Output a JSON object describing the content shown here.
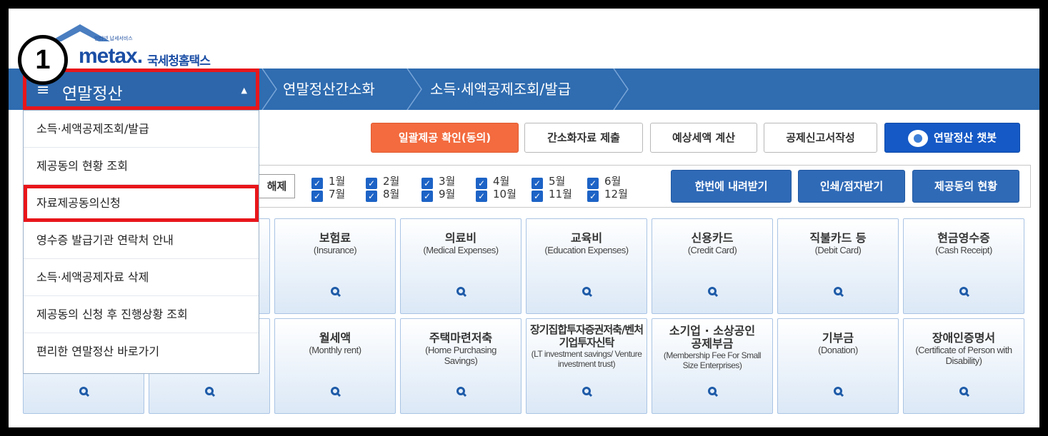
{
  "annotation": {
    "step": "1"
  },
  "logo": {
    "tagline": "인터넷 납세서비스",
    "brand": "metax.",
    "name_kr": "국세청홈택스"
  },
  "nav": {
    "menu_title": "연말정산",
    "breadcrumbs": [
      "연말정산간소화",
      "소득·세액공제조회/발급"
    ]
  },
  "dropdown": {
    "items": [
      "소득·세액공제조회/발급",
      "제공동의 현황 조회",
      "자료제공동의신청",
      "영수증 발급기관 연락처 안내",
      "소득·세액공제자료 삭제",
      "제공동의 신청 후 진행상황 조회",
      "편리한 연말정산 바로가기"
    ],
    "highlighted_index": 2
  },
  "actions": {
    "bulk_consent": "일괄제공 확인(동의)",
    "submit_data": "간소화자료 제출",
    "estimate_tax": "예상세액 계산",
    "write_return": "공제신고서작성",
    "chatbot": "연말정산 챗봇"
  },
  "filter": {
    "clear": "해제",
    "months_row1": [
      "1월",
      "2월",
      "3월",
      "4월",
      "5월",
      "6월"
    ],
    "months_row2": [
      "7월",
      "8월",
      "9월",
      "10월",
      "11월",
      "12월"
    ],
    "download_all": "한번에 내려받기",
    "print": "인쇄/점자받기",
    "consent_status": "제공동의 현황"
  },
  "tiles_row1": [
    {
      "title": "보험료",
      "en": "(Insurance)"
    },
    {
      "title": "의료비",
      "en": "(Medical Expenses)"
    },
    {
      "title": "교육비",
      "en": "(Education Expenses)"
    },
    {
      "title": "신용카드",
      "en": "(Credit Card)"
    },
    {
      "title": "직불카드 등",
      "en": "(Debit Card)"
    },
    {
      "title": "현금영수증",
      "en": "(Cash Receipt)"
    }
  ],
  "tiles_row2": [
    {
      "title": "월세액",
      "en": "(Monthly rent)"
    },
    {
      "title": "주택마련저축",
      "en": "(Home Purchasing Savings)"
    },
    {
      "title": "장기집합투자증권저축/벤처기업투자신탁",
      "en": "(LT investment savings/ Venture investment trust)"
    },
    {
      "title": "소기업 · 소상공인 공제부금",
      "en": "(Membership Fee For Small Size Enterprises)"
    },
    {
      "title": "기부금",
      "en": "(Donation)"
    },
    {
      "title": "장애인증명서",
      "en": "(Certificate of Person with Disability)"
    }
  ],
  "colors": {
    "nav": "#2f6cb0",
    "highlight": "#e8161b",
    "orange": "#f36b3f",
    "blue": "#1559c6"
  }
}
